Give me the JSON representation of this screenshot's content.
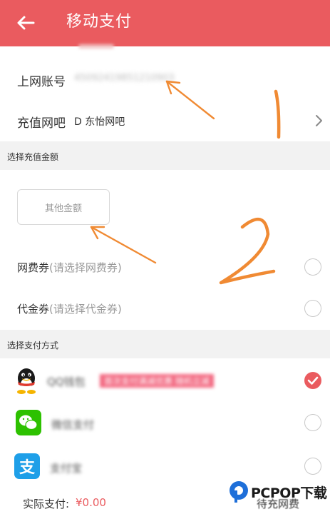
{
  "header": {
    "title": "移动支付"
  },
  "account": {
    "label": "上网账号",
    "value": "45092419851210903"
  },
  "cafe": {
    "label": "充值网吧",
    "value": "D 东怡网吧"
  },
  "section_amount": {
    "title": "选择充值金额"
  },
  "other_amount": {
    "label": "其他金额"
  },
  "voucher": {
    "label": "网费券",
    "hint": "(请选择网费券)"
  },
  "coupon": {
    "label": "代金券",
    "hint": "(请选择代金券)"
  },
  "section_payment": {
    "title": "选择支付方式"
  },
  "payment_methods": [
    {
      "name": "QQ钱包",
      "promo": "首次支付满减优惠 随机立减",
      "icon": "qq-penguin-icon",
      "selected": true
    },
    {
      "name": "微信支付",
      "icon": "wechat-icon",
      "selected": false
    },
    {
      "name": "支付宝",
      "icon": "alipay-icon",
      "selected": false
    }
  ],
  "footer": {
    "actual_pay_label": "实际支付:",
    "actual_pay_value": "¥0.00",
    "pending_label": "待充网费"
  },
  "watermark": {
    "brand": "PCPOP下载"
  },
  "annotations": {
    "number_one": "1",
    "number_two": "2"
  },
  "colors": {
    "accent": "#ea5b5f",
    "orange_annotation": "#f08a33"
  }
}
